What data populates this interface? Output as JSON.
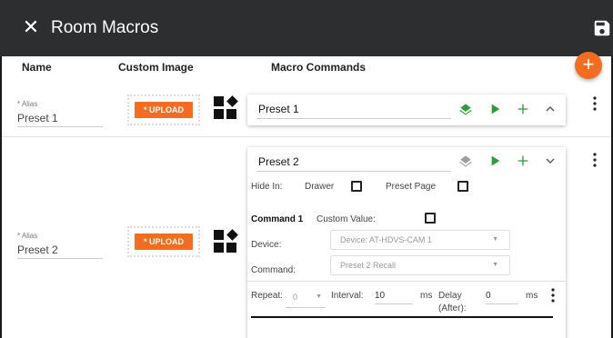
{
  "header": {
    "title": "Room Macros"
  },
  "columns": {
    "name": "Name",
    "custom_image": "Custom Image",
    "macro_commands": "Macro Commands"
  },
  "fab_label": "+",
  "rows": [
    {
      "alias_label": "* Alias",
      "alias_value": "Preset 1",
      "upload_label": "* UPLOAD",
      "macro_name": "Preset 1",
      "expanded": false
    },
    {
      "alias_label": "* Alias",
      "alias_value": "Preset 2",
      "upload_label": "* UPLOAD",
      "macro_name": "Preset 2",
      "expanded": true,
      "hide_in_label": "Hide In:",
      "drawer_label": "Drawer",
      "preset_page_label": "Preset Page",
      "command": {
        "title": "Command 1",
        "custom_value_label": "Custom Value:",
        "device_label": "Device:",
        "device_value": "Device: AT-HDVS-CAM 1",
        "command_label": "Command:",
        "command_value": "Preset 2 Recall",
        "repeat_label": "Repeat:",
        "repeat_value": "0",
        "interval_label": "Interval:",
        "interval_value": "10",
        "interval_unit": "ms",
        "delay_label_1": "Delay",
        "delay_label_2": "(After):",
        "delay_value": "0",
        "delay_unit": "ms"
      }
    }
  ],
  "colors": {
    "accent": "#f26d21",
    "header_bg": "#2d2e2f",
    "green": "#2e9c3a"
  }
}
